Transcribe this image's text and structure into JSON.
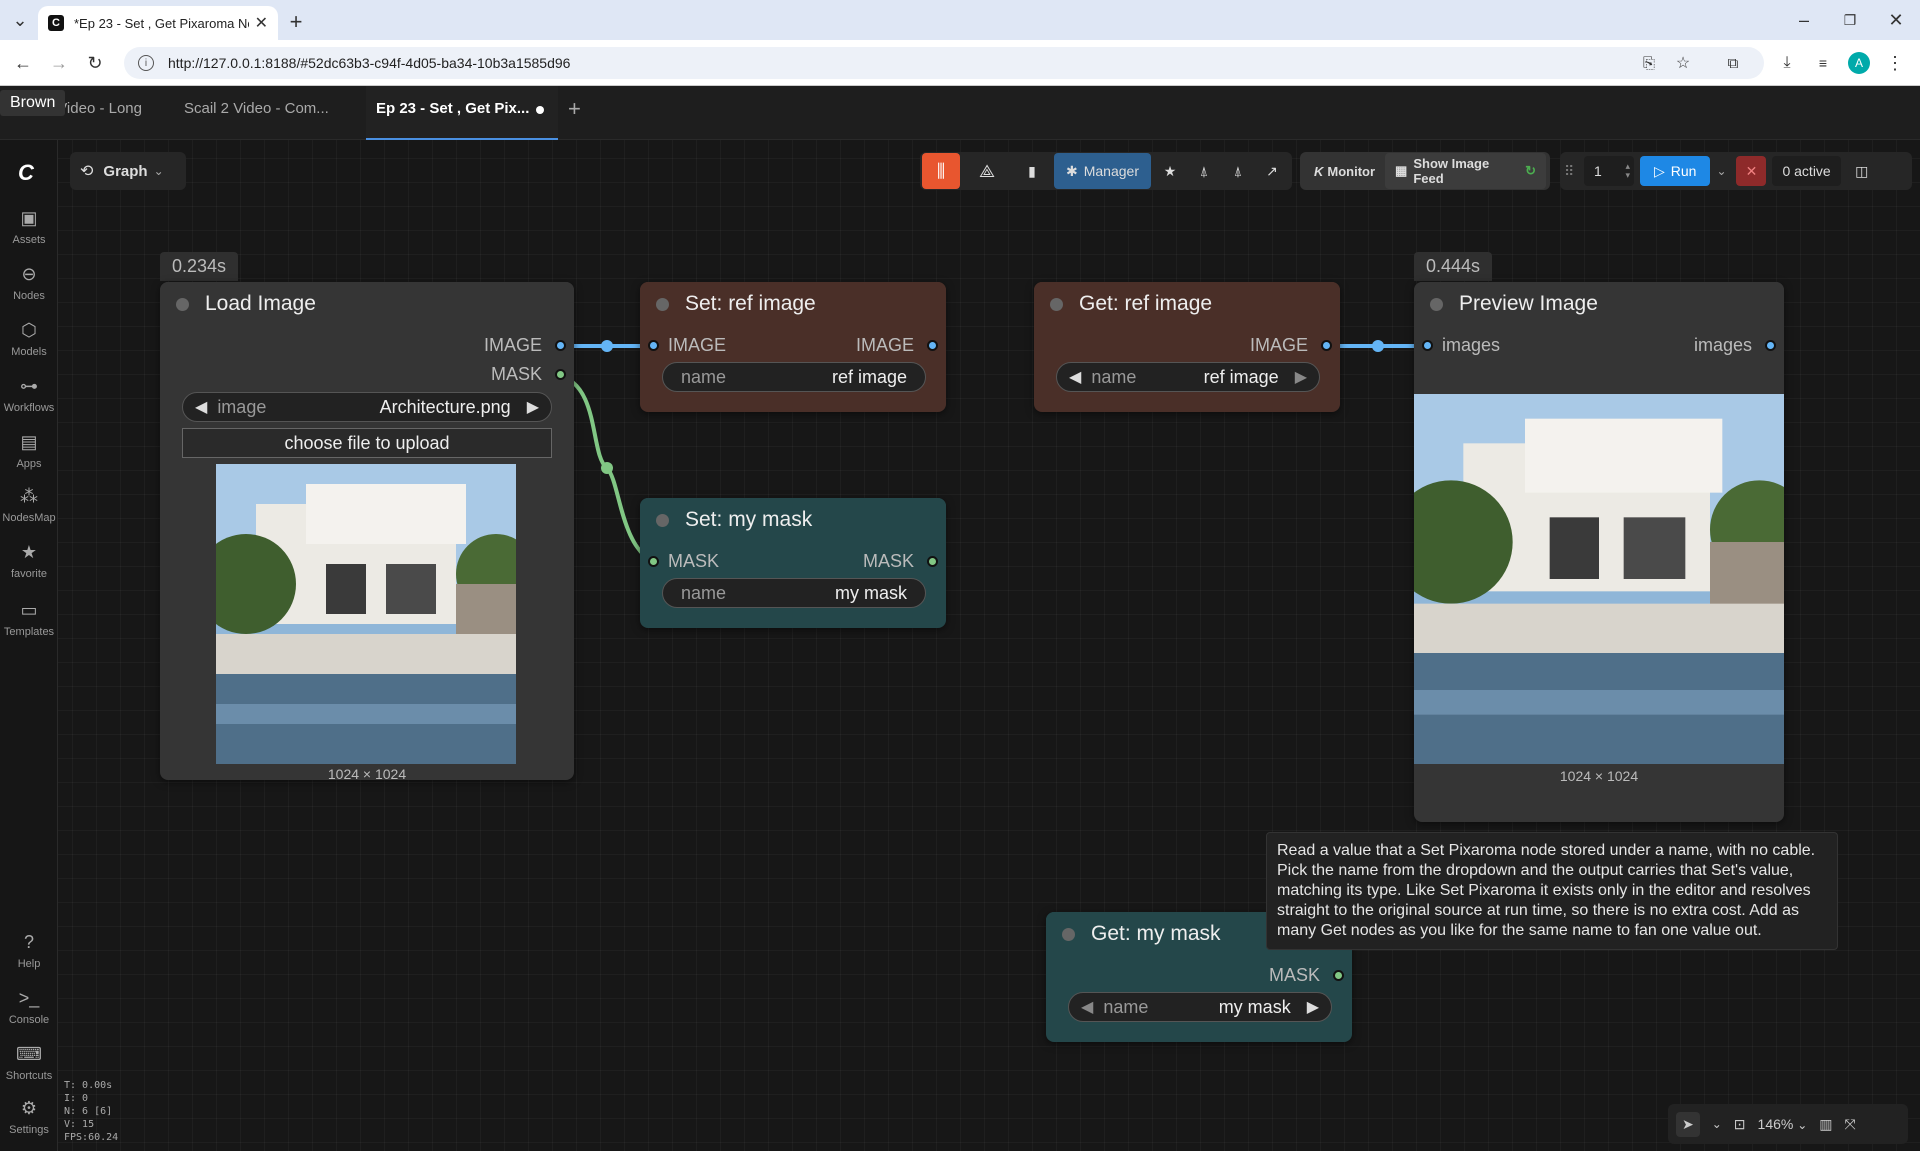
{
  "browser": {
    "tab_title": "*Ep 23 - Set , Get Pixaroma Noc",
    "url": "http://127.0.0.1:8188/#52dc63b3-c94f-4d05-ba34-10b3a1585d96",
    "profile_initial": "A"
  },
  "workflow_tabs": [
    {
      "label": "Scail 2 Video - Long"
    },
    {
      "label": "Scail 2 Video - Com..."
    },
    {
      "label": "Ep 23 - Set , Get Pix..."
    }
  ],
  "hover_tooltip": "Brown",
  "sidebar": {
    "items": [
      {
        "label": "Assets",
        "icon": "image-icon"
      },
      {
        "label": "Nodes",
        "icon": "nodes-icon"
      },
      {
        "label": "Models",
        "icon": "models-icon"
      },
      {
        "label": "Workflows",
        "icon": "workflows-icon"
      },
      {
        "label": "Apps",
        "icon": "apps-icon"
      },
      {
        "label": "NodesMap",
        "icon": "nodesmap-icon"
      },
      {
        "label": "favorite",
        "icon": "star-icon"
      },
      {
        "label": "Templates",
        "icon": "templates-icon"
      },
      {
        "label": "Help",
        "icon": "help-icon"
      },
      {
        "label": "Console",
        "icon": "console-icon"
      },
      {
        "label": "Shortcuts",
        "icon": "keyboard-icon"
      },
      {
        "label": "Settings",
        "icon": "gear-icon"
      }
    ]
  },
  "graph_menu": {
    "label": "Graph"
  },
  "toolbar": {
    "manager_label": "Manager",
    "monitor_label": "Monitor",
    "monitor_prefix": "K",
    "image_feed_label": "Show Image Feed",
    "batch_count": "1",
    "run_label": "Run",
    "active_label": "0 active"
  },
  "nodes": {
    "load_image": {
      "title": "Load Image",
      "time": "0.234s",
      "out_image": "IMAGE",
      "out_mask": "MASK",
      "widget_label": "image",
      "widget_value": "Architecture.png",
      "upload_label": "choose file to upload",
      "size": "1024 × 1024"
    },
    "set_ref": {
      "title": "Set: ref image",
      "in": "IMAGE",
      "out": "IMAGE",
      "widget_label": "name",
      "widget_value": "ref image"
    },
    "set_mask": {
      "title": "Set: my mask",
      "in": "MASK",
      "out": "MASK",
      "widget_label": "name",
      "widget_value": "my mask"
    },
    "get_ref": {
      "title": "Get: ref image",
      "out": "IMAGE",
      "widget_label": "name",
      "widget_value": "ref image"
    },
    "preview": {
      "title": "Preview Image",
      "time": "0.444s",
      "in": "images",
      "out": "images",
      "size": "1024 × 1024"
    },
    "get_mask": {
      "title": "Get: my mask",
      "out": "MASK",
      "widget_label": "name",
      "widget_value": "my mask"
    }
  },
  "node_tooltip": "Read a value that a Set Pixaroma node stored under a name, with no cable. Pick the name from the dropdown and the output carries that Set's value, matching its type. Like Set Pixaroma it exists only in the editor and resolves straight to the original source at run time, so there is no extra cost. Add as many Get nodes as you like for the same name to fan one value out.",
  "stats": [
    "T: 0.00s",
    "I: 0",
    "N: 6 [6]",
    "V: 15",
    "FPS:60.24"
  ],
  "zoom": "146%",
  "colors": {
    "accent_blue": "#1e88e5",
    "orange": "#e8562f",
    "set_brown": "#4a2f28",
    "set_teal": "#24474a",
    "link_blue": "#64b5f6",
    "link_green": "#81c784"
  }
}
